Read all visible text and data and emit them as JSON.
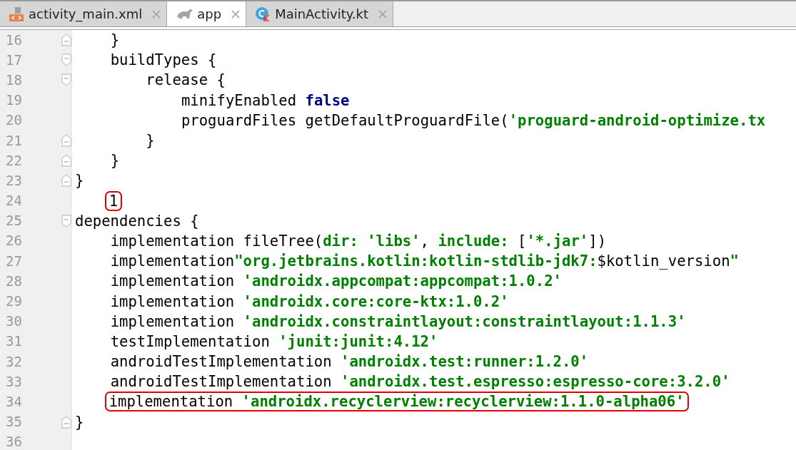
{
  "tabs": [
    {
      "label": "activity_main.xml",
      "selected": false
    },
    {
      "label": "app",
      "selected": true
    },
    {
      "label": "MainActivity.kt",
      "selected": false
    }
  ],
  "lines": [
    {
      "children": [
        {
          "number": "16",
          "fold": {
            "kind": "end"
          },
          "tokens": [
            {
              "text": "}",
              "kind": "plain"
            }
          ]
        },
        {
          "number": "17",
          "fold": {
            "kind": "start"
          },
          "tokens": [
            {
              "text": "buildTypes {",
              "kind": "plain"
            }
          ],
          "children": [
            {
              "number": "18",
              "fold": {
                "kind": "start"
              },
              "tokens": [
                {
                  "text": "release {",
                  "kind": "plain"
                }
              ],
              "children": [
                {
                  "number": "19",
                  "tokens": [
                    {
                      "text": "minifyEnabled ",
                      "kind": "plain"
                    },
                    {
                      "text": "false",
                      "kind": "keyword"
                    }
                  ]
                },
                {
                  "number": "20",
                  "tokens": [
                    {
                      "text": "proguardFiles getDefaultProguardFile(",
                      "kind": "plain"
                    },
                    {
                      "text": "'proguard-android-optimize.tx",
                      "kind": "string"
                    }
                  ]
                }
              ]
            },
            {
              "number": "21",
              "fold": {
                "kind": "end"
              },
              "tokens": [
                {
                  "text": "}",
                  "kind": "plain"
                }
              ]
            }
          ]
        },
        {
          "number": "22",
          "fold": {
            "kind": "end"
          },
          "tokens": [
            {
              "text": "}",
              "kind": "plain"
            }
          ]
        }
      ]
    },
    {
      "number": "23",
      "fold": {
        "kind": "end"
      },
      "tokens": [
        {
          "text": "}",
          "kind": "plain"
        }
      ]
    },
    {
      "children": [
        {
          "number": "24",
          "circled": true,
          "tokens": [
            {
              "text": "1",
              "kind": "plain"
            }
          ]
        }
      ]
    },
    {
      "number": "25",
      "fold": {
        "kind": "start"
      },
      "tokens": [
        {
          "text": "dependencies {",
          "kind": "plain"
        }
      ],
      "children": [
        {
          "number": "26",
          "tokens": [
            {
              "text": "implementation fileTree(",
              "kind": "plain"
            },
            {
              "text": "dir:",
              "kind": "named-arg"
            },
            {
              "text": " 'libs'",
              "kind": "string"
            },
            {
              "text": ", ",
              "kind": "plain"
            },
            {
              "text": "include:",
              "kind": "named-arg"
            },
            {
              "text": " [",
              "kind": "plain"
            },
            {
              "text": "'*.jar'",
              "kind": "string"
            },
            {
              "text": "])",
              "kind": "plain"
            }
          ]
        },
        {
          "number": "27",
          "tokens": [
            {
              "text": "implementation",
              "kind": "plain"
            },
            {
              "text": "\"org.jetbrains.kotlin:kotlin-stdlib-jdk7:",
              "kind": "string"
            },
            {
              "text": "$kotlin_version",
              "kind": "plain"
            },
            {
              "text": "\"",
              "kind": "string"
            }
          ]
        },
        {
          "number": "28",
          "tokens": [
            {
              "text": "implementation ",
              "kind": "plain"
            },
            {
              "text": "'androidx.appcompat:appcompat:1.0.2'",
              "kind": "string"
            }
          ]
        },
        {
          "number": "29",
          "tokens": [
            {
              "text": "implementation ",
              "kind": "plain"
            },
            {
              "text": "'androidx.core:core-ktx:1.0.2'",
              "kind": "string"
            }
          ]
        },
        {
          "number": "30",
          "tokens": [
            {
              "text": "implementation ",
              "kind": "plain"
            },
            {
              "text": "'androidx.constraintlayout:constraintlayout:1.1.3'",
              "kind": "string"
            }
          ]
        },
        {
          "number": "31",
          "tokens": [
            {
              "text": "testImplementation ",
              "kind": "plain"
            },
            {
              "text": "'junit:junit:4.12'",
              "kind": "string"
            }
          ]
        },
        {
          "number": "32",
          "tokens": [
            {
              "text": "androidTestImplementation ",
              "kind": "plain"
            },
            {
              "text": "'androidx.test:runner:1.2.0'",
              "kind": "string"
            }
          ]
        },
        {
          "number": "33",
          "tokens": [
            {
              "text": "androidTestImplementation ",
              "kind": "plain"
            },
            {
              "text": "'androidx.test.espresso:espresso-core:3.2.0'",
              "kind": "string"
            }
          ]
        },
        {
          "number": "34",
          "circled": true,
          "tokens": [
            {
              "text": "implementation ",
              "kind": "plain"
            },
            {
              "text": "'androidx.recyclerview:recyclerview:1.1.0-alpha06'",
              "kind": "string"
            }
          ]
        }
      ]
    },
    {
      "number": "35",
      "fold": {
        "kind": "end"
      },
      "tokens": [
        {
          "text": "}",
          "kind": "plain"
        }
      ]
    },
    {
      "number": "36"
    }
  ]
}
